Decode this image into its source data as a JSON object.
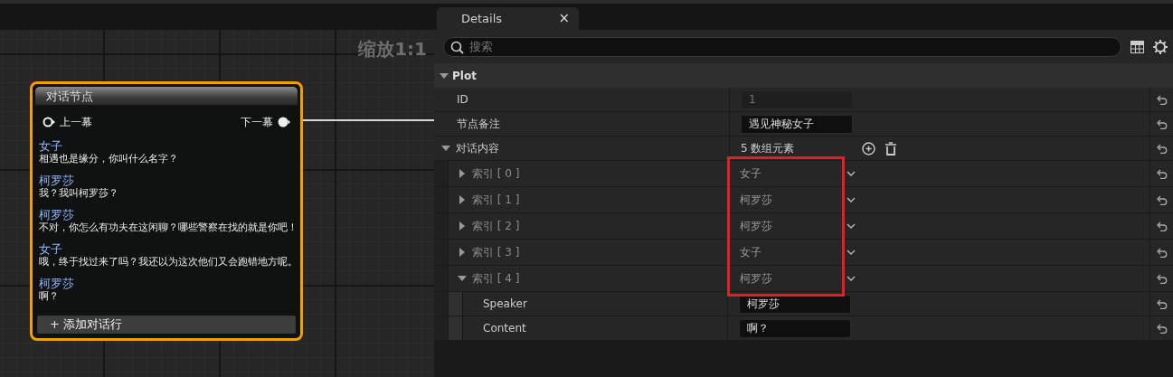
{
  "graph": {
    "zoom_label": "缩放1:1",
    "node": {
      "title": "对话节点",
      "selected": true,
      "input_pin": "上一幕",
      "output_pin": "下一幕",
      "output_connected": true,
      "lines": [
        {
          "speaker": "女子",
          "content": "相遇也是缘分，你叫什么名字？"
        },
        {
          "speaker": "柯罗莎",
          "content": "我？我叫柯罗莎？"
        },
        {
          "speaker": "柯罗莎",
          "content": "不对，你怎么有功夫在这闲聊？哪些警察在找的就是你吧！"
        },
        {
          "speaker": "女子",
          "content": "哦，终于找过来了吗？我还以为这次他们又会跑错地方呢。"
        },
        {
          "speaker": "柯罗莎",
          "content": "啊？"
        }
      ],
      "add_button": "+ 添加对话行"
    }
  },
  "details": {
    "tab": {
      "title": "Details",
      "close": "×"
    },
    "search": {
      "placeholder": "搜索"
    },
    "category": {
      "title": "Plot",
      "expanded": true
    },
    "properties": [
      {
        "kind": "field",
        "name": "ID",
        "value": "1",
        "readonly": true
      },
      {
        "kind": "field",
        "name": "节点备注",
        "value": "遇见神秘女子",
        "readonly": false
      },
      {
        "kind": "array",
        "name": "对话内容",
        "count": "5 数组元素",
        "expanded": true,
        "children": [
          {
            "kind": "element",
            "name": "索引 [ 0 ]",
            "value": "女子",
            "expanded": false,
            "highlighted": true
          },
          {
            "kind": "element",
            "name": "索引 [ 1 ]",
            "value": "柯罗莎",
            "expanded": false,
            "highlighted": true
          },
          {
            "kind": "element",
            "name": "索引 [ 2 ]",
            "value": "柯罗莎",
            "expanded": false,
            "highlighted": true
          },
          {
            "kind": "element",
            "name": "索引 [ 3 ]",
            "value": "女子",
            "expanded": false,
            "highlighted": true
          },
          {
            "kind": "element",
            "name": "索引 [ 4 ]",
            "value": "柯罗莎",
            "expanded": true,
            "highlighted": true,
            "children": [
              {
                "kind": "field",
                "name": "Speaker",
                "value": "柯罗莎",
                "readonly": false
              },
              {
                "kind": "field",
                "name": "Content",
                "value": "啊？",
                "readonly": false
              }
            ]
          }
        ]
      }
    ]
  }
}
